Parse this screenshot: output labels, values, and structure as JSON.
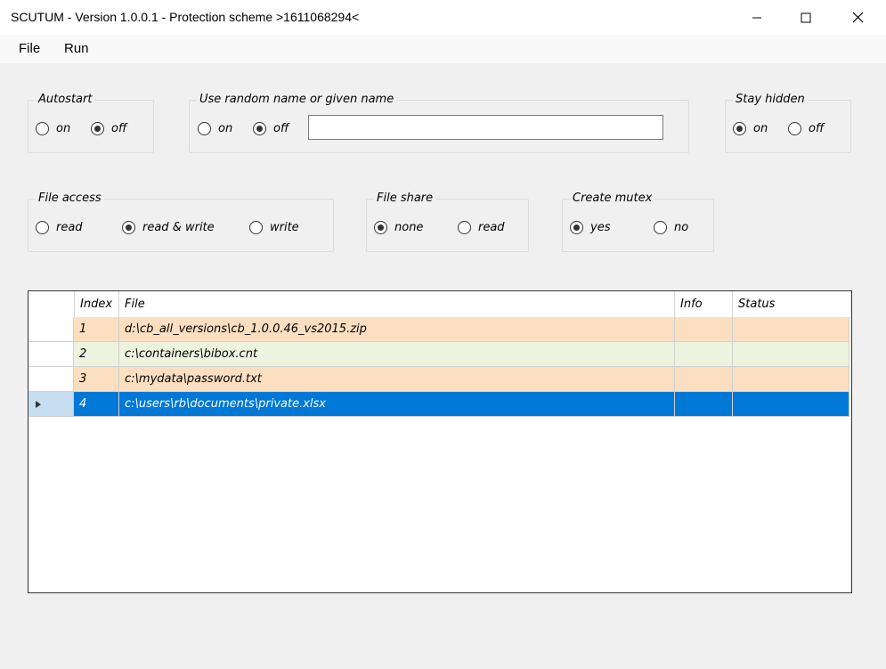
{
  "window": {
    "title": "SCUTUM - Version 1.0.0.1 - Protection scheme >1611068294<"
  },
  "menu": {
    "items": [
      {
        "label": "File"
      },
      {
        "label": "Run"
      }
    ]
  },
  "groups": {
    "autostart": {
      "legend": "Autostart",
      "options": [
        {
          "label": "on",
          "checked": false
        },
        {
          "label": "off",
          "checked": true
        }
      ]
    },
    "random_name": {
      "legend": "Use random name or given name",
      "options": [
        {
          "label": "on",
          "checked": false
        },
        {
          "label": "off",
          "checked": true
        }
      ],
      "input_value": ""
    },
    "stay_hidden": {
      "legend": "Stay hidden",
      "options": [
        {
          "label": "on",
          "checked": true
        },
        {
          "label": "off",
          "checked": false
        }
      ]
    },
    "file_access": {
      "legend": "File access",
      "options": [
        {
          "label": "read",
          "checked": false
        },
        {
          "label": "read & write",
          "checked": true
        },
        {
          "label": "write",
          "checked": false
        }
      ]
    },
    "file_share": {
      "legend": "File share",
      "options": [
        {
          "label": "none",
          "checked": true
        },
        {
          "label": "read",
          "checked": false
        }
      ]
    },
    "create_mutex": {
      "legend": "Create mutex",
      "options": [
        {
          "label": "yes",
          "checked": true
        },
        {
          "label": "no",
          "checked": false
        }
      ]
    }
  },
  "grid": {
    "columns": [
      "Index",
      "File",
      "Info",
      "Status"
    ],
    "rows": [
      {
        "index": "1",
        "file": "d:\\cb_all_versions\\cb_1.0.0.46_vs2015.zip",
        "info": "",
        "status": "",
        "color": "#fcdfc0"
      },
      {
        "index": "2",
        "file": "c:\\containers\\bibox.cnt",
        "info": "",
        "status": "",
        "color": "#eef3df"
      },
      {
        "index": "3",
        "file": "c:\\mydata\\password.txt",
        "info": "",
        "status": "",
        "color": "#fcdfc0"
      },
      {
        "index": "4",
        "file": "c:\\users\\rb\\documents\\private.xlsx",
        "info": "",
        "status": "",
        "color": "#0078d7",
        "selected": true
      }
    ]
  }
}
